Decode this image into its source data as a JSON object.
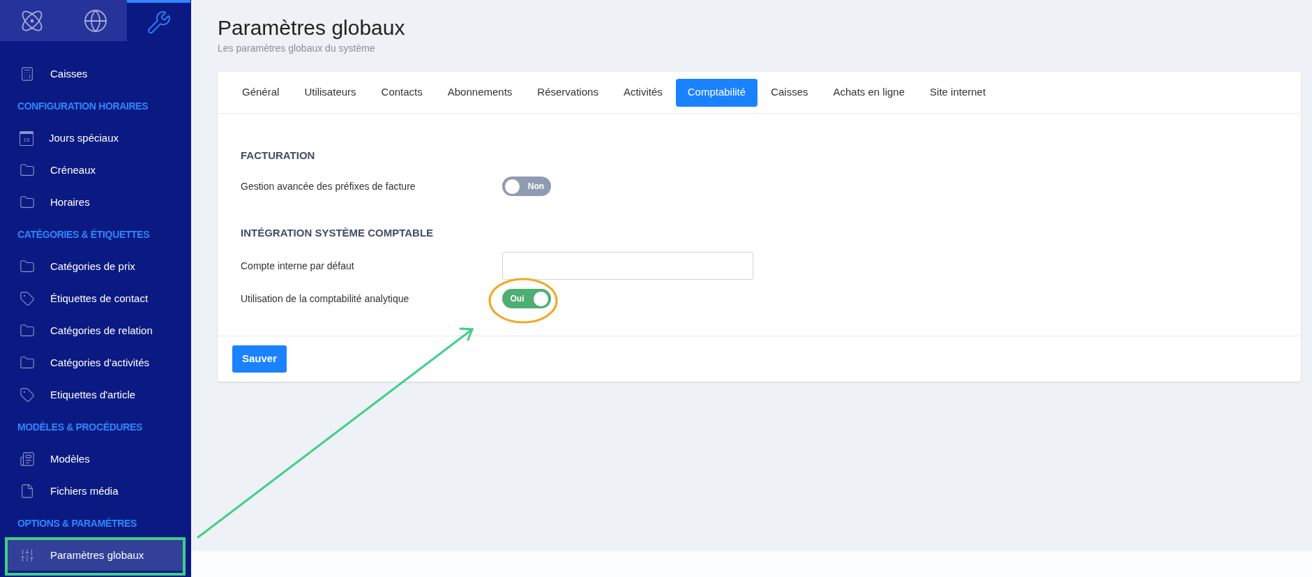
{
  "top_tabs": [
    {
      "kind": "atom",
      "selected": false
    },
    {
      "kind": "globe",
      "selected": false
    },
    {
      "kind": "tools",
      "selected": true
    }
  ],
  "sidebar": {
    "items": [
      {
        "kind": "calculator",
        "label": "Caisses",
        "selected": false
      },
      {
        "kind": "heading",
        "label": "CONFIGURATION HORAIRES"
      },
      {
        "kind": "calendar",
        "label": "Jours spéciaux",
        "selected": false,
        "badge": "15"
      },
      {
        "kind": "folder",
        "label": "Créneaux",
        "selected": false
      },
      {
        "kind": "folder",
        "label": "Horaires",
        "selected": false
      },
      {
        "kind": "heading",
        "label": "CATÉGORIES & ÉTIQUETTES"
      },
      {
        "kind": "folder",
        "label": "Catégories de prix",
        "selected": false
      },
      {
        "kind": "tag",
        "label": "Étiquettes de contact",
        "selected": false
      },
      {
        "kind": "folder",
        "label": "Catégories de relation",
        "selected": false
      },
      {
        "kind": "folder",
        "label": "Catégories d'activités",
        "selected": false
      },
      {
        "kind": "tag",
        "label": "Etiquettes d'article",
        "selected": false
      },
      {
        "kind": "heading",
        "label": "MODÈLES & PROCÉDURES"
      },
      {
        "kind": "template",
        "label": "Modèles",
        "selected": false
      },
      {
        "kind": "file",
        "label": "Fichiers média",
        "selected": false
      },
      {
        "kind": "heading",
        "label": "OPTIONS & PARAMÈTRES"
      },
      {
        "kind": "sliders",
        "label": "Paramètres globaux",
        "selected": true
      }
    ]
  },
  "page": {
    "title": "Paramètres globaux",
    "subtitle": "Les paramètres globaux du système"
  },
  "tabs": [
    {
      "label": "Général",
      "selected": false
    },
    {
      "label": "Utilisateurs",
      "selected": false
    },
    {
      "label": "Contacts",
      "selected": false
    },
    {
      "label": "Abonnements",
      "selected": false
    },
    {
      "label": "Réservations",
      "selected": false
    },
    {
      "label": "Activités",
      "selected": false
    },
    {
      "label": "Comptabilité",
      "selected": true
    },
    {
      "label": "Caisses",
      "selected": false
    },
    {
      "label": "Achats en ligne",
      "selected": false
    },
    {
      "label": "Site internet",
      "selected": false
    }
  ],
  "sections": [
    {
      "title": "FACTURATION",
      "fields": [
        {
          "kind": "toggle",
          "label": "Gestion avancée des préfixes de facture",
          "on": false,
          "text": "Non"
        }
      ]
    },
    {
      "title": "INTÉGRATION SYSTÈME COMPTABLE",
      "fields": [
        {
          "kind": "input",
          "label": "Compte interne par défaut"
        },
        {
          "kind": "toggle",
          "label": "Utilisation de la comptabilité analytique",
          "on": true,
          "text": "Oui"
        }
      ]
    }
  ],
  "save_button": "Sauver"
}
